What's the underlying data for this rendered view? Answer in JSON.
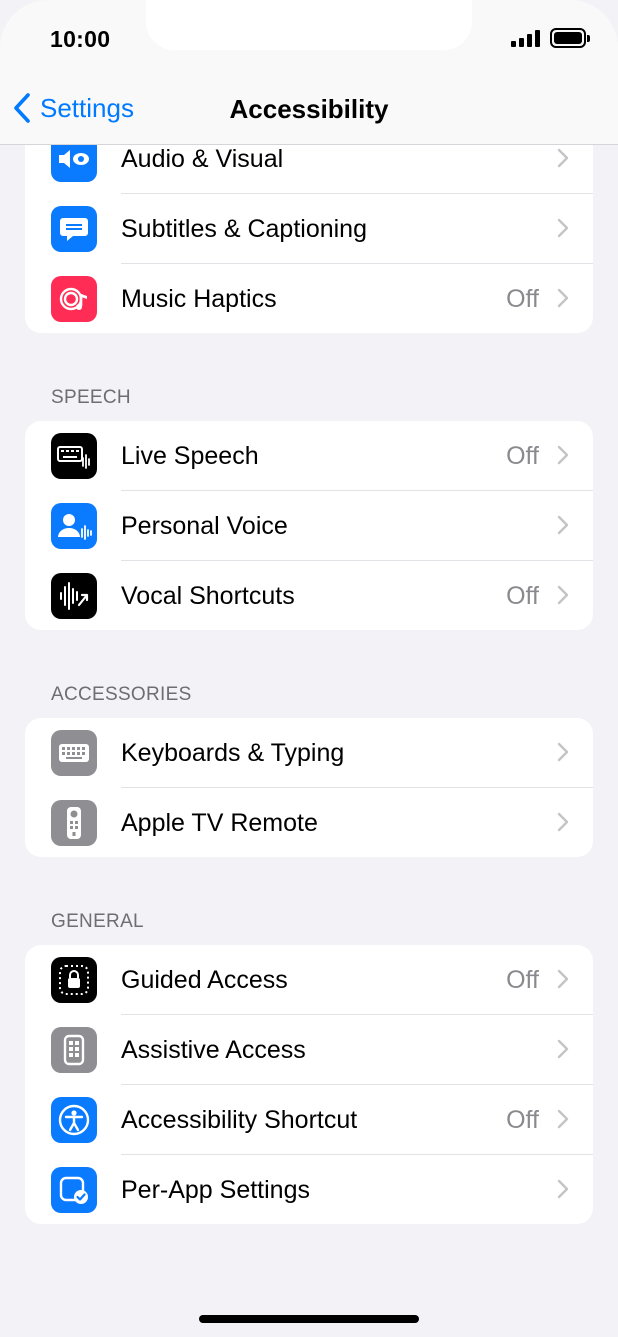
{
  "status_bar": {
    "time": "10:00"
  },
  "nav": {
    "back_label": "Settings",
    "title": "Accessibility"
  },
  "colors": {
    "accent": "#007aff",
    "blue": "#0a7aff",
    "pink": "#ff2d55",
    "black": "#000000",
    "gray": "#8e8e93"
  },
  "groups": {
    "vision": {
      "items": [
        {
          "label": "Audio & Visual",
          "value": "",
          "icon": "speaker-eye-icon"
        },
        {
          "label": "Subtitles & Captioning",
          "value": "",
          "icon": "captions-bubble-icon"
        },
        {
          "label": "Music Haptics",
          "value": "Off",
          "icon": "music-haptics-icon"
        }
      ]
    },
    "speech": {
      "header": "SPEECH",
      "items": [
        {
          "label": "Live Speech",
          "value": "Off",
          "icon": "keyboard-waveform-icon"
        },
        {
          "label": "Personal Voice",
          "value": "",
          "icon": "person-waveform-icon"
        },
        {
          "label": "Vocal Shortcuts",
          "value": "Off",
          "icon": "waveform-arrow-icon"
        }
      ]
    },
    "accessories": {
      "header": "ACCESSORIES",
      "items": [
        {
          "label": "Keyboards & Typing",
          "value": "",
          "icon": "keyboard-icon"
        },
        {
          "label": "Apple TV Remote",
          "value": "",
          "icon": "tv-remote-icon"
        }
      ]
    },
    "general": {
      "header": "GENERAL",
      "items": [
        {
          "label": "Guided Access",
          "value": "Off",
          "icon": "lock-dotted-frame-icon"
        },
        {
          "label": "Assistive Access",
          "value": "",
          "icon": "assistive-access-icon"
        },
        {
          "label": "Accessibility Shortcut",
          "value": "Off",
          "icon": "accessibility-person-icon"
        },
        {
          "label": "Per-App Settings",
          "value": "",
          "icon": "app-checkmark-icon"
        }
      ]
    }
  }
}
